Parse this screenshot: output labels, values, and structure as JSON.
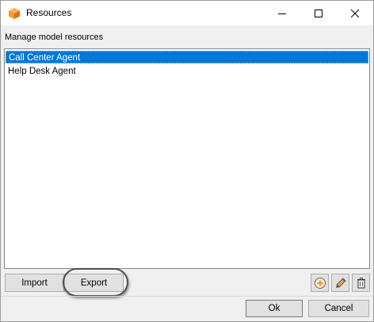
{
  "window": {
    "title": "Resources"
  },
  "titlebar": {
    "minimize_icon": "minimize-icon",
    "maximize_icon": "maximize-icon",
    "close_icon": "close-icon"
  },
  "label": "Manage model resources",
  "list": {
    "items": [
      "Call Center Agent",
      "Help Desk Agent"
    ],
    "selected_index": 0
  },
  "buttons": {
    "import": "Import",
    "export": "Export",
    "ok": "Ok",
    "cancel": "Cancel"
  },
  "icons": {
    "add": "add-icon",
    "edit": "pencil-icon",
    "delete": "trash-icon"
  },
  "colors": {
    "selection": "#0078d7",
    "app_icon": "#f08a24"
  }
}
